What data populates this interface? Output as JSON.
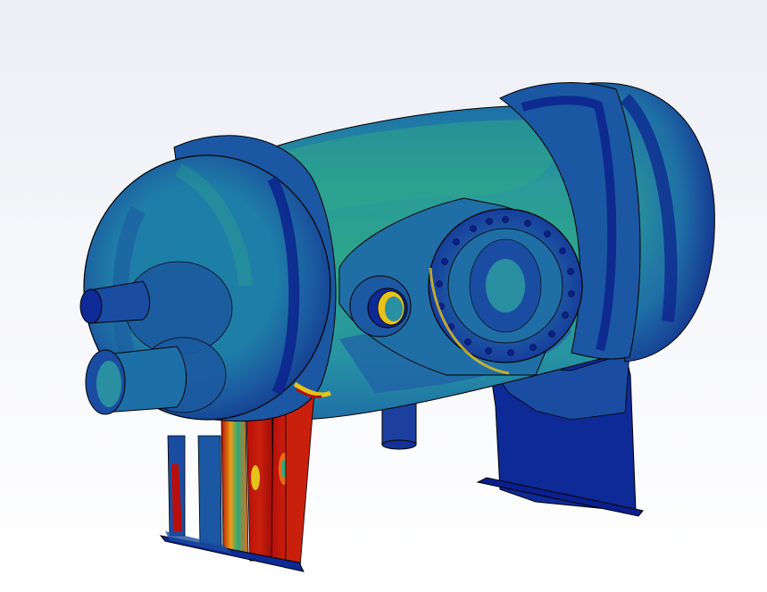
{
  "scene": {
    "model": "pressure-vessel",
    "background_gradient": [
      "#eceef4",
      "#ffffff"
    ]
  },
  "stress_colormap": {
    "low": "#0a1f8f",
    "low_mid": "#1f4fa0",
    "mid": "#1f8f9a",
    "mid_high": "#2faa7a",
    "high": "#e8c21a",
    "very_high": "#e8611a",
    "max": "#b80f0a"
  }
}
